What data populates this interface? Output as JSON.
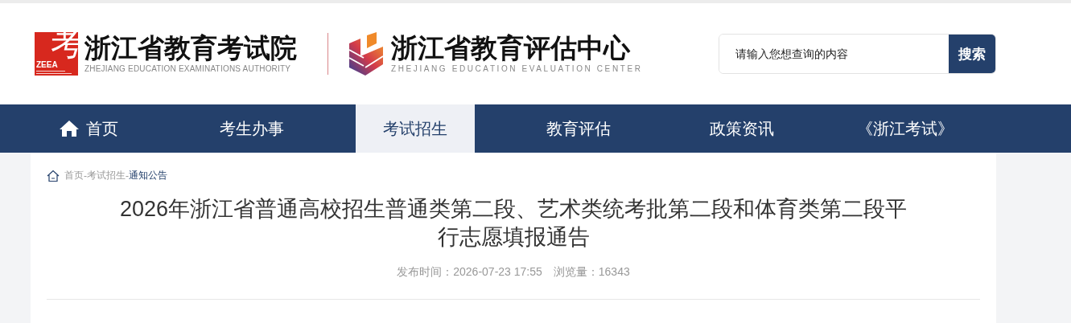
{
  "header": {
    "logo_left": {
      "mark_char": "考",
      "mark_abbr": "ZEEA",
      "title": "浙江省教育考试院",
      "subtitle": "ZHEJIANG EDUCATION EXAMINATIONS AUTHORITY"
    },
    "logo_right": {
      "title": "浙江省教育评估中心",
      "subtitle": "ZHEJIANG EDUCATION EVALUATION CENTER"
    },
    "search": {
      "placeholder": "请输入您想查询的内容",
      "button": "搜索"
    }
  },
  "nav": [
    {
      "label": "首页",
      "kind": "home",
      "selected": false
    },
    {
      "label": "考生办事",
      "kind": "plain",
      "selected": false
    },
    {
      "label": "考试招生",
      "kind": "plain",
      "selected": true
    },
    {
      "label": "教育评估",
      "kind": "plain",
      "selected": false
    },
    {
      "label": "政策资讯",
      "kind": "plain",
      "selected": false
    },
    {
      "label": "《浙江考试》",
      "kind": "plain",
      "selected": false
    }
  ],
  "breadcrumb_separator": "-",
  "breadcrumb": [
    {
      "label": "首页",
      "current": false
    },
    {
      "label": "考试招生",
      "current": false
    },
    {
      "label": "通知公告",
      "current": true
    }
  ],
  "article": {
    "title": "2026年浙江省普通高校招生普通类第二段、艺术类统考批第二段和体育类第二段平行志愿填报通告",
    "published": "发布时间：2026-07-23 17:55",
    "views": "浏览量：16343"
  }
}
